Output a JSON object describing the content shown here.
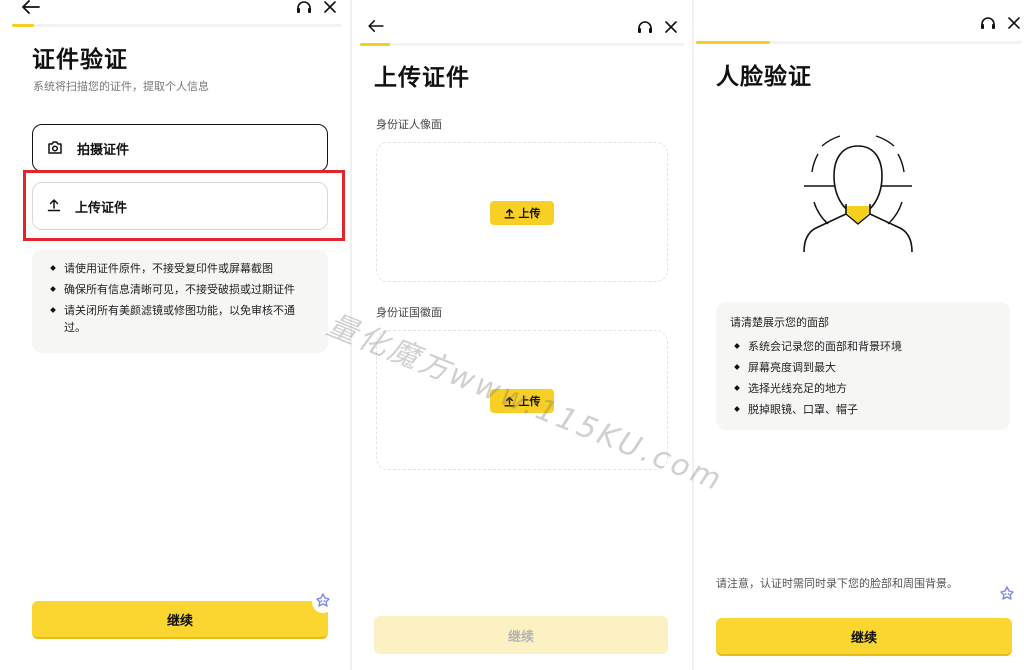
{
  "panels": {
    "doc_verify": {
      "title": "证件验证",
      "subtitle": "系统将扫描您的证件，提取个人信息",
      "options": [
        {
          "label": "拍摄证件",
          "icon": "camera-icon"
        },
        {
          "label": "上传证件",
          "icon": "upload-icon"
        }
      ],
      "tips": [
        "请使用证件原件，不接受复印件或屏幕截图",
        "确保所有信息清晰可见，不接受破损或过期证件",
        "请关闭所有美颜滤镜或修图功能，以免审核不通过。"
      ],
      "continue_label": "继续"
    },
    "upload_doc": {
      "title": "上传证件",
      "front_label": "身份证人像面",
      "back_label": "身份证国徽面",
      "upload_label": "上传",
      "continue_label": "继续"
    },
    "face_verify": {
      "title": "人脸验证",
      "tips_head": "请清楚展示您的面部",
      "tips": [
        "系统会记录您的面部和背景环境",
        "屏幕亮度调到最大",
        "选择光线充足的地方",
        "脱掉眼镜、口罩、帽子"
      ],
      "note": "请注意，认证时需同时录下您的脸部和周围背景。",
      "continue_label": "继续"
    }
  },
  "icons": [
    "back-arrow-icon",
    "headset-icon",
    "close-icon",
    "camera-icon",
    "upload-icon",
    "face-scan-illustration",
    "assistant-icon"
  ],
  "watermark": "量化魔方www.115KU.com",
  "colors": {
    "accent": "#fbd530",
    "highlight": "#e3262a",
    "disabled_button": "#fbf1c2"
  }
}
